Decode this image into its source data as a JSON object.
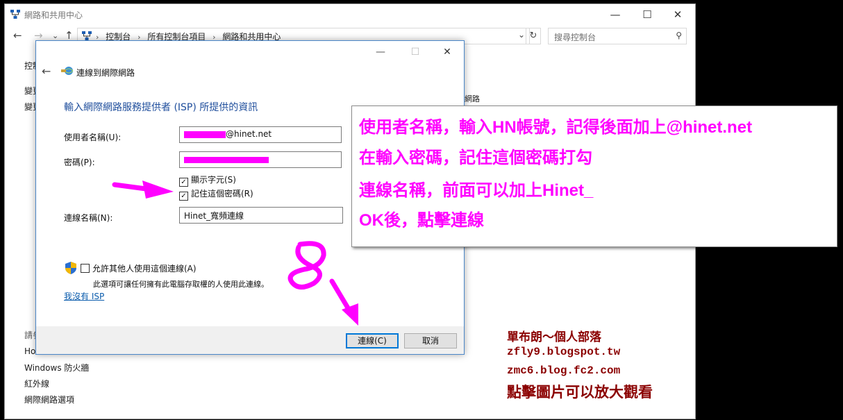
{
  "background_window": {
    "title": "網路和共用中心",
    "controls": {
      "minimize": "—",
      "maximize": "☐",
      "close": "✕"
    },
    "nav": {
      "back": "←",
      "forward": "→",
      "dropdown": "⌄",
      "up": "↑"
    },
    "breadcrumbs": [
      "控制台",
      "所有控制台項目",
      "網路和共用中心"
    ],
    "breadcrumb_separator": "›",
    "address_dropdown": "⌄",
    "refresh": "↻",
    "search_placeholder": "搜尋控制台",
    "search_glyph": "⚲",
    "sidebar_top": [
      "控制",
      "變更",
      "變更"
    ],
    "sidebar_bottom_heading": "請參",
    "sidebar_links": [
      "Ho",
      "Windows 防火牆",
      "紅外線",
      "網際網路選項"
    ],
    "partial_text": "網路"
  },
  "dialog": {
    "controls": {
      "minimize": "—",
      "maximize": "☐",
      "close": "✕"
    },
    "back": "←",
    "title": "連線到網際網路",
    "heading": "輸入網際網路服務提供者 (ISP) 所提供的資訊",
    "username_label": "使用者名稱(U):",
    "username_value": "@hinet.net",
    "password_label": "密碼(P):",
    "show_chars_label": "顯示字元(S)",
    "show_chars_checked": true,
    "remember_label": "記住這個密碼(R)",
    "remember_checked": true,
    "checkmark": "✓",
    "connection_name_label": "連線名稱(N):",
    "connection_name_value": "Hinet_寬頻連線",
    "allow_others_label": "允許其他人使用這個連線(A)",
    "allow_others_checked": false,
    "allow_others_desc": "此選項可讓任何擁有此電腦存取權的人使用此連線。",
    "no_isp_link": "我沒有 ISP",
    "connect_button": "連線(C)",
    "cancel_button": "取消"
  },
  "callout": {
    "lines": [
      "使用者名稱，輸入HN帳號，記得後面加上@hinet.net",
      "在輸入密碼，記住這個密碼打勾",
      "連線名稱，前面可以加上Hinet_",
      "OK後，點擊連線"
    ]
  },
  "watermark": {
    "lines": [
      "單布朗～個人部落",
      "zfly9.blogspot.tw",
      "zmc6.blog.fc2.com",
      "點擊圖片可以放大觀看"
    ]
  },
  "colors": {
    "annotation": "#ff00ff",
    "watermark": "#8b0000",
    "link": "#0b5cad",
    "heading": "#1f4e9c"
  }
}
